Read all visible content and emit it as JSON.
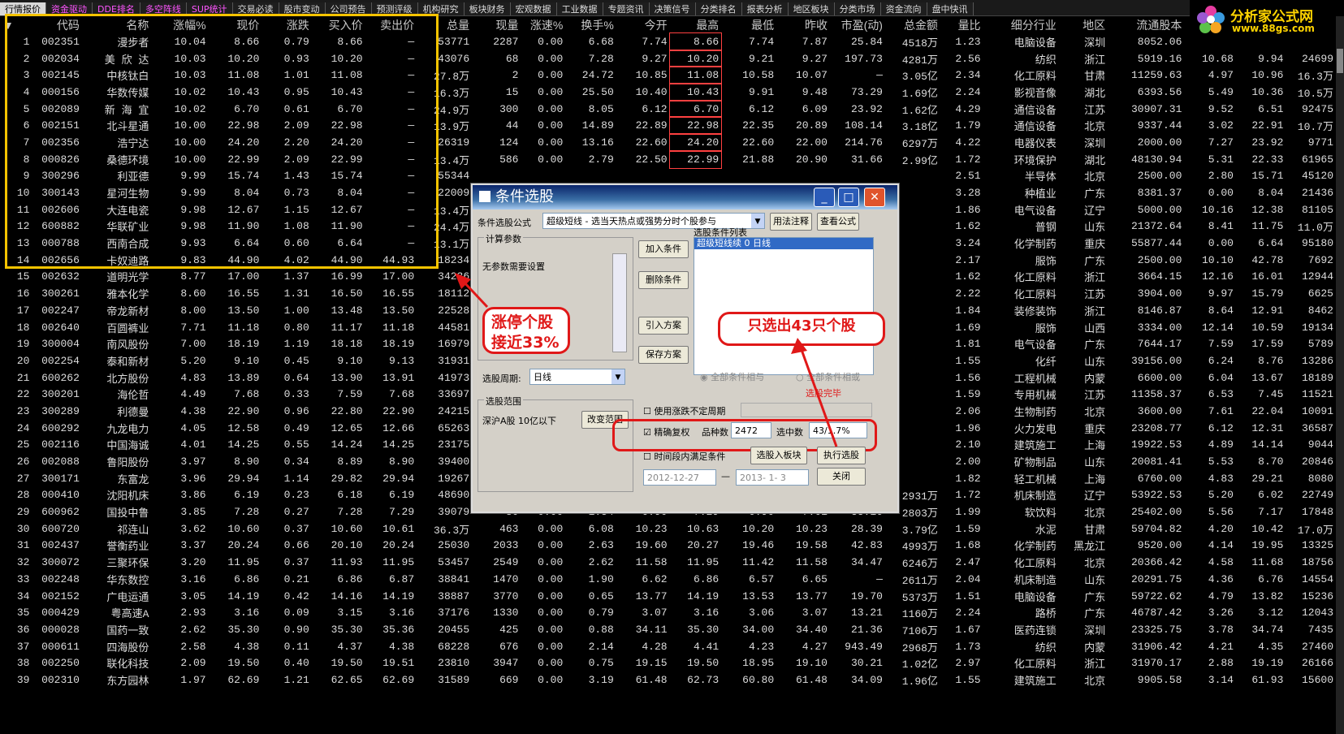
{
  "tabs": [
    "行情报价",
    "资金驱动",
    "DDE排名",
    "多空阵线",
    "SUP统计",
    "交易必读",
    "股市变动",
    "公司预告",
    "预测评级",
    "机构研究",
    "板块财务",
    "宏观数据",
    "工业数据",
    "专题资讯",
    "决策信号",
    "分类排名",
    "报表分析",
    "地区板块",
    "分类市场",
    "资金流向",
    "盘中快讯"
  ],
  "logo": {
    "title": "分析家公式网",
    "url": "www.88gs.com"
  },
  "columns": [
    "代码",
    "名称",
    "涨幅%",
    "现价",
    "涨跌",
    "买入价",
    "卖出价",
    "总量",
    "现量",
    "涨速%",
    "换手%",
    "今开",
    "最高",
    "最低",
    "昨收",
    "市盈(动)",
    "总金额",
    "量比",
    "细分行业",
    "地区",
    "流通股本",
    "",
    ""
  ],
  "rows": [
    [
      "1",
      "002351",
      "漫步者",
      "10.04",
      "8.66",
      "0.79",
      "8.66",
      "—",
      "53771",
      "2287",
      "0.00",
      "6.68",
      "7.74",
      "8.66",
      "7.74",
      "7.87",
      "25.84",
      "4518万",
      "1.23",
      "电脑设备",
      "深圳",
      "8052.06",
      "",
      ""
    ],
    [
      "2",
      "002034",
      "美 欣 达",
      "10.03",
      "10.20",
      "0.93",
      "10.20",
      "—",
      "43076",
      "68",
      "0.00",
      "7.28",
      "9.27",
      "10.20",
      "9.21",
      "9.27",
      "197.73",
      "4281万",
      "2.56",
      "纺织",
      "浙江",
      "5919.16",
      "10.68",
      "9.94",
      "24699"
    ],
    [
      "3",
      "002145",
      "中核钛白",
      "10.03",
      "11.08",
      "1.01",
      "11.08",
      "—",
      "27.8万",
      "2",
      "0.00",
      "24.72",
      "10.85",
      "11.08",
      "10.58",
      "10.07",
      "—",
      "3.05亿",
      "2.34",
      "化工原料",
      "甘肃",
      "11259.63",
      "4.97",
      "10.96",
      "16.3万"
    ],
    [
      "4",
      "000156",
      "华数传媒",
      "10.02",
      "10.43",
      "0.95",
      "10.43",
      "—",
      "16.3万",
      "15",
      "0.00",
      "25.50",
      "10.40",
      "10.43",
      "9.91",
      "9.48",
      "73.29",
      "1.69亿",
      "2.24",
      "影视音像",
      "湖北",
      "6393.56",
      "5.49",
      "10.36",
      "10.5万"
    ],
    [
      "5",
      "002089",
      "新 海 宜",
      "10.02",
      "6.70",
      "0.61",
      "6.70",
      "—",
      "24.9万",
      "300",
      "0.00",
      "8.05",
      "6.12",
      "6.70",
      "6.12",
      "6.09",
      "23.92",
      "1.62亿",
      "4.29",
      "通信设备",
      "江苏",
      "30907.31",
      "9.52",
      "6.51",
      "92475"
    ],
    [
      "6",
      "002151",
      "北斗星通",
      "10.00",
      "22.98",
      "2.09",
      "22.98",
      "—",
      "13.9万",
      "44",
      "0.00",
      "14.89",
      "22.89",
      "22.98",
      "22.35",
      "20.89",
      "108.14",
      "3.18亿",
      "1.79",
      "通信设备",
      "北京",
      "9337.44",
      "3.02",
      "22.91",
      "10.7万"
    ],
    [
      "7",
      "002356",
      "浩宁达",
      "10.00",
      "24.20",
      "2.20",
      "24.20",
      "—",
      "26319",
      "124",
      "0.00",
      "13.16",
      "22.60",
      "24.20",
      "22.60",
      "22.00",
      "214.76",
      "6297万",
      "4.22",
      "电器仪表",
      "深圳",
      "2000.00",
      "7.27",
      "23.92",
      "9771"
    ],
    [
      "8",
      "000826",
      "桑德环境",
      "10.00",
      "22.99",
      "2.09",
      "22.99",
      "—",
      "13.4万",
      "586",
      "0.00",
      "2.79",
      "22.50",
      "22.99",
      "21.88",
      "20.90",
      "31.66",
      "2.99亿",
      "1.72",
      "环境保护",
      "湖北",
      "48130.94",
      "5.31",
      "22.33",
      "61965"
    ],
    [
      "9",
      "300296",
      "利亚德",
      "9.99",
      "15.74",
      "1.43",
      "15.74",
      "—",
      "55344",
      "",
      "",
      "",
      "",
      "",
      "",
      "",
      "",
      "",
      "2.51",
      "半导体",
      "北京",
      "2500.00",
      "2.80",
      "15.71",
      "45120"
    ],
    [
      "10",
      "300143",
      "星河生物",
      "9.99",
      "8.04",
      "0.73",
      "8.04",
      "—",
      "22009",
      "",
      "",
      "",
      "",
      "",
      "",
      "",
      "",
      "",
      "3.28",
      "种植业",
      "广东",
      "8381.37",
      "0.00",
      "8.04",
      "21436"
    ],
    [
      "11",
      "002606",
      "大连电瓷",
      "9.98",
      "12.67",
      "1.15",
      "12.67",
      "—",
      "13.4万",
      "",
      "",
      "",
      "",
      "",
      "",
      "",
      "",
      "",
      "1.86",
      "电气设备",
      "辽宁",
      "5000.00",
      "10.16",
      "12.38",
      "81105"
    ],
    [
      "12",
      "600882",
      "华联矿业",
      "9.98",
      "11.90",
      "1.08",
      "11.90",
      "—",
      "24.4万",
      "",
      "",
      "",
      "",
      "",
      "",
      "",
      "",
      "",
      "1.62",
      "普钢",
      "山东",
      "21372.64",
      "8.41",
      "11.75",
      "11.0万"
    ],
    [
      "13",
      "000788",
      "西南合成",
      "9.93",
      "6.64",
      "0.60",
      "6.64",
      "—",
      "13.1万",
      "",
      "",
      "",
      "",
      "",
      "",
      "",
      "",
      "",
      "3.24",
      "化学制药",
      "重庆",
      "55877.44",
      "0.00",
      "6.64",
      "95180"
    ],
    [
      "14",
      "002656",
      "卡奴迪路",
      "9.83",
      "44.90",
      "4.02",
      "44.90",
      "44.93",
      "18234",
      "",
      "",
      "",
      "",
      "",
      "",
      "",
      "",
      "",
      "2.17",
      "服饰",
      "广东",
      "2500.00",
      "10.10",
      "42.78",
      "7692"
    ],
    [
      "15",
      "002632",
      "道明光学",
      "8.77",
      "17.00",
      "1.37",
      "16.99",
      "17.00",
      "34236",
      "",
      "",
      "",
      "",
      "",
      "",
      "",
      "",
      "",
      "1.62",
      "化工原料",
      "浙江",
      "3664.15",
      "12.16",
      "16.01",
      "12944"
    ],
    [
      "16",
      "300261",
      "雅本化学",
      "8.60",
      "16.55",
      "1.31",
      "16.50",
      "16.55",
      "18112",
      "",
      "",
      "",
      "",
      "",
      "",
      "",
      "",
      "",
      "2.22",
      "化工原料",
      "江苏",
      "3904.00",
      "9.97",
      "15.79",
      "6625"
    ],
    [
      "17",
      "002247",
      "帝龙新材",
      "8.00",
      "13.50",
      "1.00",
      "13.48",
      "13.50",
      "22528",
      "",
      "",
      "",
      "",
      "",
      "",
      "",
      "",
      "",
      "1.84",
      "装修装饰",
      "浙江",
      "8146.87",
      "8.64",
      "12.91",
      "8462"
    ],
    [
      "18",
      "002640",
      "百圆裤业",
      "7.71",
      "11.18",
      "0.80",
      "11.17",
      "11.18",
      "44581",
      "",
      "",
      "",
      "",
      "",
      "",
      "",
      "",
      "",
      "1.69",
      "服饰",
      "山西",
      "3334.00",
      "12.14",
      "10.59",
      "19134"
    ],
    [
      "19",
      "300004",
      "南风股份",
      "7.00",
      "18.19",
      "1.19",
      "18.18",
      "18.19",
      "16979",
      "",
      "",
      "",
      "",
      "",
      "",
      "",
      "",
      "",
      "1.81",
      "电气设备",
      "广东",
      "7644.17",
      "7.59",
      "17.59",
      "5789"
    ],
    [
      "20",
      "002254",
      "泰和新材",
      "5.20",
      "9.10",
      "0.45",
      "9.10",
      "9.13",
      "31931",
      "",
      "",
      "",
      "",
      "",
      "",
      "",
      "",
      "",
      "1.55",
      "化纤",
      "山东",
      "39156.00",
      "6.24",
      "8.76",
      "13286"
    ],
    [
      "21",
      "600262",
      "北方股份",
      "4.83",
      "13.89",
      "0.64",
      "13.90",
      "13.91",
      "41973",
      "",
      "",
      "",
      "",
      "",
      "",
      "",
      "",
      "",
      "1.56",
      "工程机械",
      "内蒙",
      "6600.00",
      "6.04",
      "13.67",
      "18189"
    ],
    [
      "22",
      "300201",
      "海伦哲",
      "4.49",
      "7.68",
      "0.33",
      "7.59",
      "7.68",
      "33697",
      "",
      "",
      "",
      "",
      "",
      "",
      "",
      "",
      "",
      "1.59",
      "专用机械",
      "江苏",
      "11358.37",
      "6.53",
      "7.45",
      "11521"
    ],
    [
      "23",
      "300289",
      "利德曼",
      "4.38",
      "22.90",
      "0.96",
      "22.80",
      "22.90",
      "24215",
      "",
      "",
      "",
      "",
      "",
      "",
      "",
      "",
      "",
      "2.06",
      "生物制药",
      "北京",
      "3600.00",
      "7.61",
      "22.04",
      "10091"
    ],
    [
      "24",
      "600292",
      "九龙电力",
      "4.05",
      "12.58",
      "0.49",
      "12.65",
      "12.66",
      "65263",
      "",
      "",
      "",
      "",
      "",
      "",
      "",
      "",
      "",
      "1.96",
      "火力发电",
      "重庆",
      "23208.77",
      "6.12",
      "12.31",
      "36587"
    ],
    [
      "25",
      "002116",
      "中国海诚",
      "4.01",
      "14.25",
      "0.55",
      "14.24",
      "14.25",
      "23175",
      "",
      "",
      "",
      "",
      "",
      "",
      "",
      "",
      "",
      "2.10",
      "建筑施工",
      "上海",
      "19922.53",
      "4.89",
      "14.14",
      "9044"
    ],
    [
      "26",
      "002088",
      "鲁阳股份",
      "3.97",
      "8.90",
      "0.34",
      "8.89",
      "8.90",
      "39400",
      "",
      "",
      "",
      "",
      "",
      "",
      "",
      "",
      "",
      "2.00",
      "矿物制品",
      "山东",
      "20081.41",
      "5.53",
      "8.70",
      "20846"
    ],
    [
      "27",
      "300171",
      "东富龙",
      "3.96",
      "29.94",
      "1.14",
      "29.82",
      "29.94",
      "19267",
      "",
      "",
      "",
      "",
      "",
      "",
      "",
      "",
      "",
      "1.82",
      "轻工机械",
      "上海",
      "6760.00",
      "4.83",
      "29.21",
      "8080"
    ],
    [
      "28",
      "000410",
      "沈阳机床",
      "3.86",
      "6.19",
      "0.23",
      "6.18",
      "6.19",
      "48690",
      "5646",
      "0.00",
      "0.90",
      "5.98",
      "6.19",
      "5.88",
      "5.96",
      "121.24",
      "2931万",
      "1.72",
      "机床制造",
      "辽宁",
      "53922.53",
      "5.20",
      "6.02",
      "22749"
    ],
    [
      "29",
      "600962",
      "国投中鲁",
      "3.85",
      "7.28",
      "0.27",
      "7.28",
      "7.29",
      "39079",
      "80",
      "0.00",
      "1.54",
      "6.90",
      "7.29",
      "6.90",
      "7.01",
      "33.16",
      "2803万",
      "1.99",
      "软饮料",
      "北京",
      "25402.00",
      "5.56",
      "7.17",
      "17848"
    ],
    [
      "30",
      "600720",
      "祁连山",
      "3.62",
      "10.60",
      "0.37",
      "10.60",
      "10.61",
      "36.3万",
      "463",
      "0.00",
      "6.08",
      "10.23",
      "10.63",
      "10.20",
      "10.23",
      "28.39",
      "3.79亿",
      "1.59",
      "水泥",
      "甘肃",
      "59704.82",
      "4.20",
      "10.42",
      "17.0万"
    ],
    [
      "31",
      "002437",
      "誉衡药业",
      "3.37",
      "20.24",
      "0.66",
      "20.10",
      "20.24",
      "25030",
      "2033",
      "0.00",
      "2.63",
      "19.60",
      "20.27",
      "19.46",
      "19.58",
      "42.83",
      "4993万",
      "1.68",
      "化学制药",
      "黑龙江",
      "9520.00",
      "4.14",
      "19.95",
      "13325"
    ],
    [
      "32",
      "300072",
      "三聚环保",
      "3.20",
      "11.95",
      "0.37",
      "11.93",
      "11.95",
      "53457",
      "2549",
      "0.00",
      "2.62",
      "11.58",
      "11.95",
      "11.42",
      "11.58",
      "34.47",
      "6246万",
      "2.47",
      "化工原料",
      "北京",
      "20366.42",
      "4.58",
      "11.68",
      "18756"
    ],
    [
      "33",
      "002248",
      "华东数控",
      "3.16",
      "6.86",
      "0.21",
      "6.86",
      "6.87",
      "38841",
      "1470",
      "0.00",
      "1.90",
      "6.62",
      "6.86",
      "6.57",
      "6.65",
      "—",
      "2611万",
      "2.04",
      "机床制造",
      "山东",
      "20291.75",
      "4.36",
      "6.76",
      "14554"
    ],
    [
      "34",
      "002152",
      "广电运通",
      "3.05",
      "14.19",
      "0.42",
      "14.16",
      "14.19",
      "38887",
      "3770",
      "0.00",
      "0.65",
      "13.77",
      "14.19",
      "13.53",
      "13.77",
      "19.70",
      "5373万",
      "1.51",
      "电脑设备",
      "广东",
      "59722.62",
      "4.79",
      "13.82",
      "15236"
    ],
    [
      "35",
      "000429",
      "粤高速A",
      "2.93",
      "3.16",
      "0.09",
      "3.15",
      "3.16",
      "37176",
      "1330",
      "0.00",
      "0.79",
      "3.07",
      "3.16",
      "3.06",
      "3.07",
      "13.21",
      "1160万",
      "2.24",
      "路桥",
      "广东",
      "46787.42",
      "3.26",
      "3.12",
      "12043"
    ],
    [
      "36",
      "000028",
      "国药一致",
      "2.62",
      "35.30",
      "0.90",
      "35.30",
      "35.36",
      "20455",
      "425",
      "0.00",
      "0.88",
      "34.11",
      "35.30",
      "34.00",
      "34.40",
      "21.36",
      "7106万",
      "1.67",
      "医药连锁",
      "深圳",
      "23325.75",
      "3.78",
      "34.74",
      "7435"
    ],
    [
      "37",
      "000611",
      "四海股份",
      "2.58",
      "4.38",
      "0.11",
      "4.37",
      "4.38",
      "68228",
      "676",
      "0.00",
      "2.14",
      "4.28",
      "4.41",
      "4.23",
      "4.27",
      "943.49",
      "2968万",
      "1.73",
      "纺织",
      "内蒙",
      "31906.42",
      "4.21",
      "4.35",
      "27460"
    ],
    [
      "38",
      "002250",
      "联化科技",
      "2.09",
      "19.50",
      "0.40",
      "19.50",
      "19.51",
      "23810",
      "3947",
      "0.00",
      "0.75",
      "19.15",
      "19.50",
      "18.95",
      "19.10",
      "30.21",
      "1.02亿",
      "2.97",
      "化工原料",
      "浙江",
      "31970.17",
      "2.88",
      "19.19",
      "26166"
    ],
    [
      "39",
      "002310",
      "东方园林",
      "1.97",
      "62.69",
      "1.21",
      "62.65",
      "62.69",
      "31589",
      "669",
      "0.00",
      "3.19",
      "61.48",
      "62.73",
      "60.80",
      "61.48",
      "34.09",
      "1.96亿",
      "1.55",
      "建筑施工",
      "北京",
      "9905.58",
      "3.14",
      "61.93",
      "15600"
    ]
  ],
  "dialog": {
    "title": "条件选股",
    "formula_label": "条件选股公式",
    "formula_value": "超级短线 - 选当天热点或强势分时个股参与",
    "btn_usage": "用法注释",
    "btn_view": "查看公式",
    "params_group": "计算参数",
    "params_text": "无参数需要设置",
    "list_label": "选股条件列表",
    "list_item": "超级短线续  0  日线",
    "btn_add": "加入条件",
    "btn_del": "删除条件",
    "btn_import": "引入方案",
    "btn_save": "保存方案",
    "radio_and": "全部条件相与",
    "radio_or": "全部条件相或",
    "done_text": "选股完毕",
    "period_label": "选股周期:",
    "period_value": "日线",
    "range_group": "选股范围",
    "range_text": "深沪A股 10亿以下",
    "btn_range": "改变范围",
    "chk_unfixed": "使用涨跌不定周期",
    "chk_exact": "精确复权",
    "count_label": "品种数",
    "count_value": "2472",
    "selected_label": "选中数",
    "selected_value": "43/1.7%",
    "chk_time": "时间段内满足条件",
    "btn_to_block": "选股入板块",
    "btn_run": "执行选股",
    "date_from": "2012-12-27",
    "date_to": "2013- 1- 3",
    "btn_close": "关闭"
  },
  "callouts": {
    "left_line1": "涨停个股",
    "left_line2": "接近33%",
    "right": "只选出43只个股"
  }
}
